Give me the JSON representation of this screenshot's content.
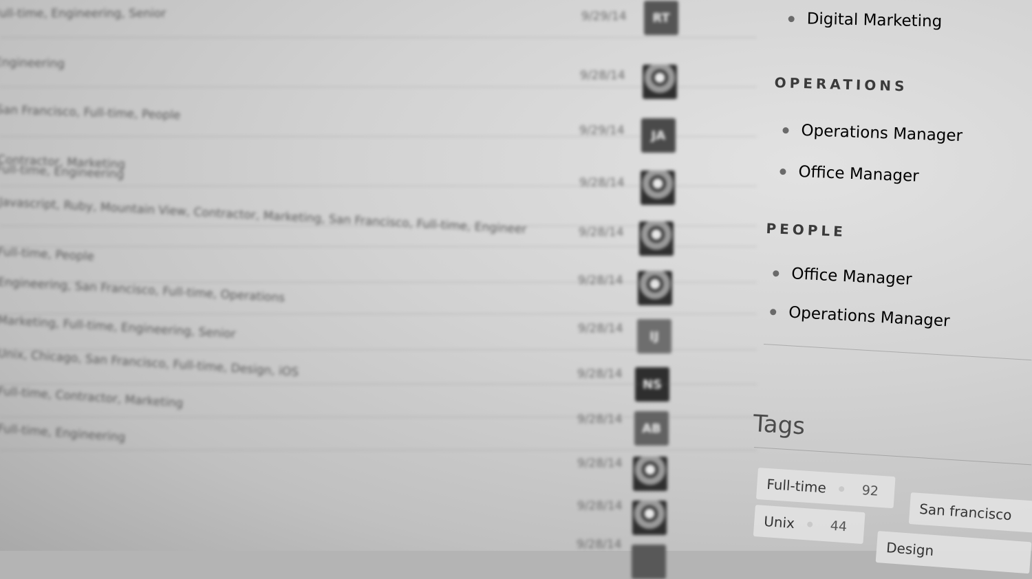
{
  "rows": [
    {
      "tags": "Full-time, Engineering, Senior",
      "date": "9/29/14",
      "avatar": {
        "type": "initials",
        "text": "RT"
      }
    },
    {
      "tags": "Engineering",
      "date": "9/28/14",
      "avatar": {
        "type": "photo"
      }
    },
    {
      "tags": "San Francisco, Full-time, People",
      "date": "9/29/14",
      "avatar": {
        "type": "initials",
        "text": "JA"
      }
    },
    {
      "tags": "Contractor, Marketing",
      "date": "9/28/14",
      "avatar": {
        "type": "photo"
      }
    },
    {
      "tags": "Full-time, Engineering",
      "date": "9/28/14",
      "avatar": {
        "type": "photo"
      }
    },
    {
      "tags": "Javascript, Ruby, Mountain View, Contractor, Marketing, San Francisco, Full-time, Engineer",
      "date": "9/28/14",
      "avatar": {
        "type": "photo"
      }
    },
    {
      "tags": "Full-time, People",
      "date": "9/28/14",
      "avatar": {
        "type": "initials",
        "text": "IJ"
      }
    },
    {
      "tags": "Engineering, San Francisco, Full-time, Operations",
      "date": "9/28/14",
      "avatar": {
        "type": "initials",
        "text": "NS"
      }
    },
    {
      "tags": "Marketing, Full-time, Engineering, Senior",
      "date": "9/28/14",
      "avatar": {
        "type": "initials",
        "text": "AB"
      }
    },
    {
      "tags": "Unix, Chicago, San Francisco, Full-time, Design, iOS",
      "date": "9/28/14",
      "avatar": {
        "type": "photo"
      }
    },
    {
      "tags": "Full-time, Contractor, Marketing",
      "date": "9/28/14",
      "avatar": {
        "type": "photo"
      }
    },
    {
      "tags": "Full-time, Engineering",
      "date": "9/28/14",
      "avatar": {
        "type": "initials",
        "text": ""
      }
    }
  ],
  "sidebar": {
    "top_item": "Digital Marketing",
    "operations": {
      "heading": "OPERATIONS",
      "items": [
        "Operations Manager",
        "Office Manager"
      ]
    },
    "people": {
      "heading": "PEOPLE",
      "items": [
        "Office Manager",
        "Operations Manager"
      ]
    },
    "tags": {
      "title": "Tags",
      "chips": [
        {
          "label": "Full-time",
          "count": "92"
        },
        {
          "label": "San francisco",
          "count": ""
        },
        {
          "label": "Unix",
          "count": "44"
        },
        {
          "label": "Design",
          "count": ""
        }
      ]
    }
  },
  "colors": {
    "avatar_rt": "#555555",
    "avatar_ja": "#4a4a4a",
    "avatar_ij": "#6e6e6e",
    "avatar_ns": "#2e2e2e",
    "avatar_ab": "#626262"
  }
}
